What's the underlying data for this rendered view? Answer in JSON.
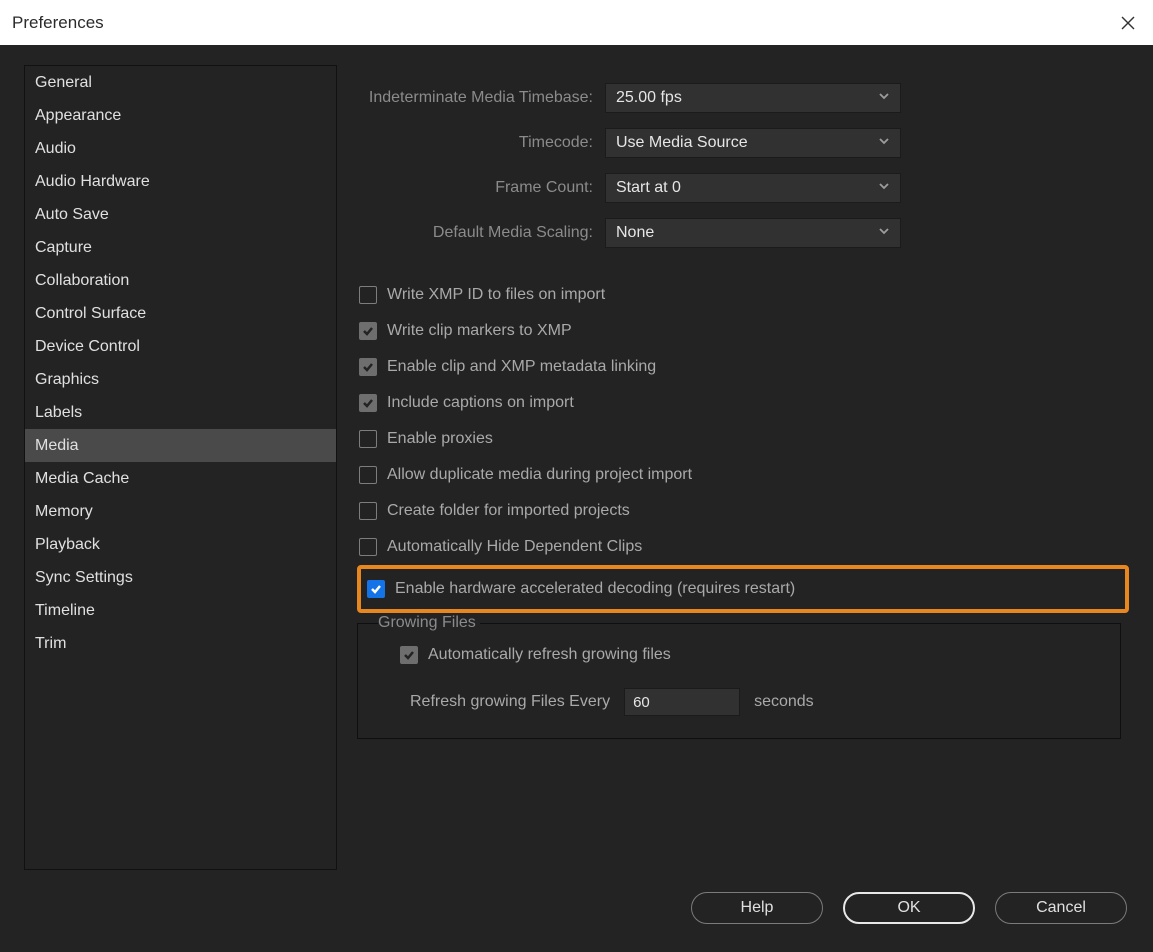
{
  "window": {
    "title": "Preferences"
  },
  "sidebar": {
    "items": [
      "General",
      "Appearance",
      "Audio",
      "Audio Hardware",
      "Auto Save",
      "Capture",
      "Collaboration",
      "Control Surface",
      "Device Control",
      "Graphics",
      "Labels",
      "Media",
      "Media Cache",
      "Memory",
      "Playback",
      "Sync Settings",
      "Timeline",
      "Trim"
    ],
    "selected_index": 11
  },
  "form": {
    "timebase": {
      "label": "Indeterminate Media Timebase:",
      "value": "25.00 fps"
    },
    "timecode": {
      "label": "Timecode:",
      "value": "Use Media Source"
    },
    "framecount": {
      "label": "Frame Count:",
      "value": "Start at 0"
    },
    "scaling": {
      "label": "Default Media Scaling:",
      "value": "None"
    }
  },
  "checks": [
    {
      "label": "Write XMP ID to files on import",
      "checked": false
    },
    {
      "label": "Write clip markers to XMP",
      "checked": true
    },
    {
      "label": "Enable clip and XMP metadata linking",
      "checked": true
    },
    {
      "label": "Include captions on import",
      "checked": true
    },
    {
      "label": "Enable proxies",
      "checked": false
    },
    {
      "label": "Allow duplicate media during project import",
      "checked": false
    },
    {
      "label": "Create folder for imported projects",
      "checked": false
    },
    {
      "label": "Automatically Hide Dependent Clips",
      "checked": false
    },
    {
      "label": "Enable hardware accelerated decoding (requires restart)",
      "checked": true,
      "blue": true,
      "highlight": true
    }
  ],
  "growing": {
    "title": "Growing Files",
    "auto_label": "Automatically refresh growing files",
    "auto_checked": true,
    "refresh_label": "Refresh growing Files Every",
    "refresh_value": "60",
    "seconds_label": "seconds"
  },
  "buttons": {
    "help": "Help",
    "ok": "OK",
    "cancel": "Cancel"
  }
}
